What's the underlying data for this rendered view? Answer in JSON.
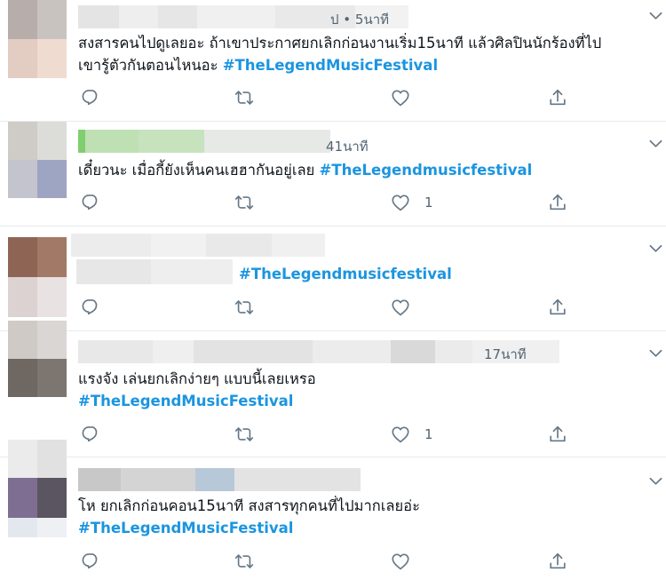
{
  "colors": {
    "hashtag": "#1b95e0",
    "meta": "#536471",
    "icon": "#657786",
    "divider": "#e6ecf0"
  },
  "tweets": [
    {
      "time": "ป • 5นาที",
      "text_lines": [
        "สงสารคนไปดูเลยอะ ถ้าเขาประกาศยกเลิกก่อนงานเริ่ม15นาที แล้วศิลปินนักร้องที่ไป",
        "เขารู้ตัวกันตอนไหนอะ"
      ],
      "hashtag": "#TheLegendMusicFestival",
      "reply_icon": "reply-icon",
      "retweet_icon": "retweet-icon",
      "like_icon": "heart-icon",
      "share_icon": "share-icon",
      "like_count": ""
    },
    {
      "time": "41นาที",
      "text_lines": [
        "เดี๋ยวนะ เมื่อกี้ยังเห็นคนเฮฮากันอยู่เลย"
      ],
      "hashtag": "#TheLegendmusicfestival",
      "like_count": "1"
    },
    {
      "time": "",
      "text_lines": [],
      "hashtag": "#TheLegendmusicfestival",
      "like_count": ""
    },
    {
      "time": "17นาที",
      "text_lines": [
        "แรงจัง เล่นยกเลิกง่ายๆ แบบนี้เลยเหรอ"
      ],
      "hashtag": "#TheLegendMusicFestival",
      "like_count": "1"
    },
    {
      "time": "",
      "text_lines": [
        "โห ยกเลิกก่อนคอน15นาที สงสารทุกคนที่ไปมากเลยอ่ะ"
      ],
      "hashtag": "#TheLegendMusicFestival",
      "like_count": ""
    }
  ]
}
